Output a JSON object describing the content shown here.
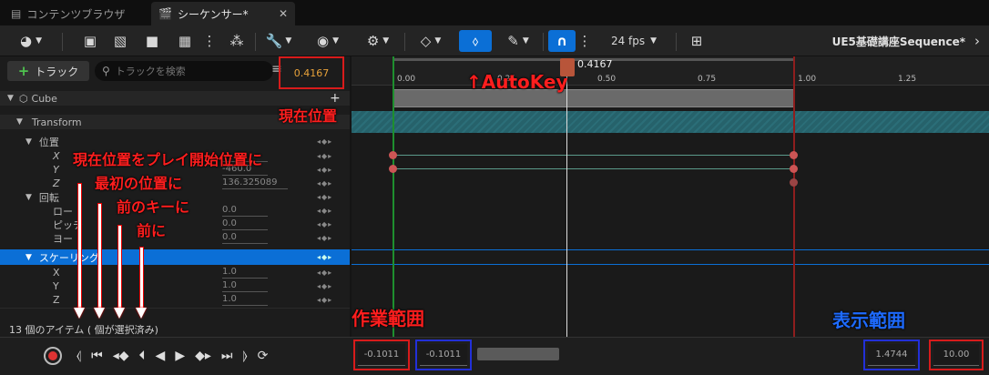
{
  "tabs": [
    {
      "label": "コンテンツブラウザ",
      "icon": "folder-icon"
    },
    {
      "label": "シーケンサー*",
      "icon": "clapper-icon"
    }
  ],
  "toolbar": {
    "fps": "24 fps",
    "sequence_name": "UE5基礎講座Sequence*"
  },
  "outliner": {
    "add_track_label": "トラック",
    "search_placeholder": "トラックを検索",
    "current_time": "0.4167",
    "rows": [
      {
        "label": "Cube",
        "indent": 0
      },
      {
        "label": "Transform",
        "indent": 1
      },
      {
        "label": "位置",
        "indent": 2
      },
      {
        "label": "X",
        "value": ""
      },
      {
        "label": "Y",
        "value": "-460.0"
      },
      {
        "label": "Z",
        "value": "136.325089"
      },
      {
        "label": "回転",
        "indent": 2
      },
      {
        "label": "ロー",
        "value": "0.0"
      },
      {
        "label": "ピッチ",
        "value": "0.0"
      },
      {
        "label": "ヨー",
        "value": "0.0"
      },
      {
        "label": "スケーリング",
        "indent": 2,
        "selected": true
      },
      {
        "label": "X",
        "value": "1.0"
      },
      {
        "label": "Y",
        "value": "1.0"
      },
      {
        "label": "Z",
        "value": "1.0"
      }
    ],
    "status": "13 個のアイテム ( 個が選択済み)"
  },
  "timeline": {
    "playhead_label": "0.4167",
    "ticks": [
      "0.00",
      "0.25",
      "0.50",
      "0.75",
      "1.00",
      "1.25"
    ],
    "range_start": "-0.1011",
    "view_start": "-0.1011",
    "view_end": "1.4744",
    "range_end": "10.00"
  },
  "annotations": {
    "autokey": "↑AutoKey",
    "current_position": "現在位置",
    "set_play_start": "現在位置をプレイ開始位置に",
    "to_first": "最初の位置に",
    "to_prev_key": "前のキーに",
    "to_prev": "前に",
    "work_range": "作業範囲",
    "view_range": "表示範囲"
  },
  "colors": {
    "accent": "#0b6fd6",
    "annotation_red": "#ff1e1e",
    "annotation_blue": "#1e6bff",
    "selected_row": "#0b6fd6",
    "section_bar": "#2e7a86"
  }
}
